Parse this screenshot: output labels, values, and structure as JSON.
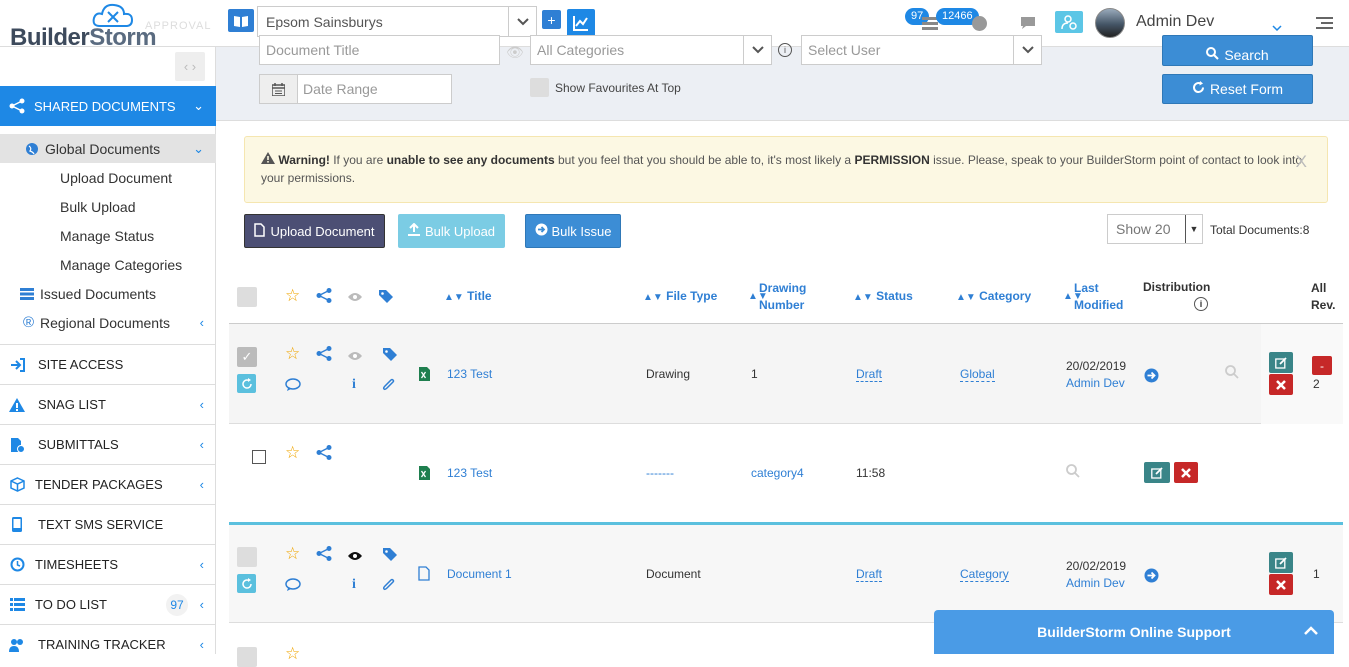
{
  "brand": {
    "name_part1": "Builder",
    "name_part2": "Storm",
    "ghost_text": "APPROVAL"
  },
  "header": {
    "site": "Epsom Sainsburys",
    "badge_tasks": "97",
    "badge_notifications": "12466",
    "user_name": "Admin Dev",
    "add_label": "+"
  },
  "sidebar": {
    "main": "SHARED DOCUMENTS",
    "subitems": [
      {
        "label": "Global Documents"
      },
      {
        "label": "Upload Document"
      },
      {
        "label": "Bulk Upload"
      },
      {
        "label": "Manage Status"
      },
      {
        "label": "Manage Categories"
      },
      {
        "label": "Issued Documents"
      },
      {
        "label": "Regional Documents"
      }
    ],
    "sections": [
      {
        "label": "SITE ACCESS"
      },
      {
        "label": "SNAG LIST"
      },
      {
        "label": "SUBMITTALS"
      },
      {
        "label": "TENDER PACKAGES"
      },
      {
        "label": "TEXT SMS SERVICE"
      },
      {
        "label": "TIMESHEETS"
      },
      {
        "label": "TO DO LIST",
        "badge": "97"
      },
      {
        "label": "TRAINING TRACKER"
      }
    ]
  },
  "filters": {
    "title_placeholder": "Document Title",
    "category": "All Categories",
    "user_placeholder": "Select User",
    "date_placeholder": "Date Range",
    "favourites_label": "Show Favourites At Top",
    "search_label": "Search",
    "reset_label": "Reset Form"
  },
  "warning": {
    "strong": "Warning!",
    "t1": " If you are ",
    "b1": "unable to see any documents",
    "t2": " but you feel that you should be able to, it's most likely a ",
    "b2": "PERMISSION",
    "t3": " issue. Please, speak to your BuilderStorm point of contact to look into your permissions.",
    "close": "X"
  },
  "actions": {
    "upload": "Upload Document",
    "bulk_upload": "Bulk Upload",
    "bulk_issue": "Bulk Issue",
    "show": "Show 20",
    "total": "Total Documents:8"
  },
  "table": {
    "headers": {
      "title": "Title",
      "file_type": "File Type",
      "drawing_number_1": "Drawing",
      "drawing_number_2": "Number",
      "status": "Status",
      "category": "Category",
      "last_modified_1": "Last",
      "last_modified_2": "Modified",
      "distribution": "Distribution",
      "all_rev_1": "All",
      "all_rev_2": "Rev."
    },
    "rows": [
      {
        "title": "123 Test",
        "file_type": "Drawing",
        "drawing_number": "1",
        "status": "Draft",
        "category": "Global",
        "date": "20/02/2019",
        "by": "Admin Dev",
        "rev": "2",
        "rev_btn": "-"
      },
      {
        "title": "123 Test",
        "file_type": "-------",
        "drawing_number": "category4",
        "status": "11:58"
      },
      {
        "title": "Document 1",
        "file_type": "Document",
        "status": "Draft",
        "category": "Category",
        "date": "20/02/2019",
        "by": "Admin Dev",
        "rev": "1"
      }
    ]
  },
  "support": {
    "label": "BuilderStorm Online Support"
  },
  "colors": {
    "accent": "#1e88e5",
    "teal": "#3a8588",
    "danger": "#c62828",
    "warning_bg": "#fcf8e3"
  }
}
